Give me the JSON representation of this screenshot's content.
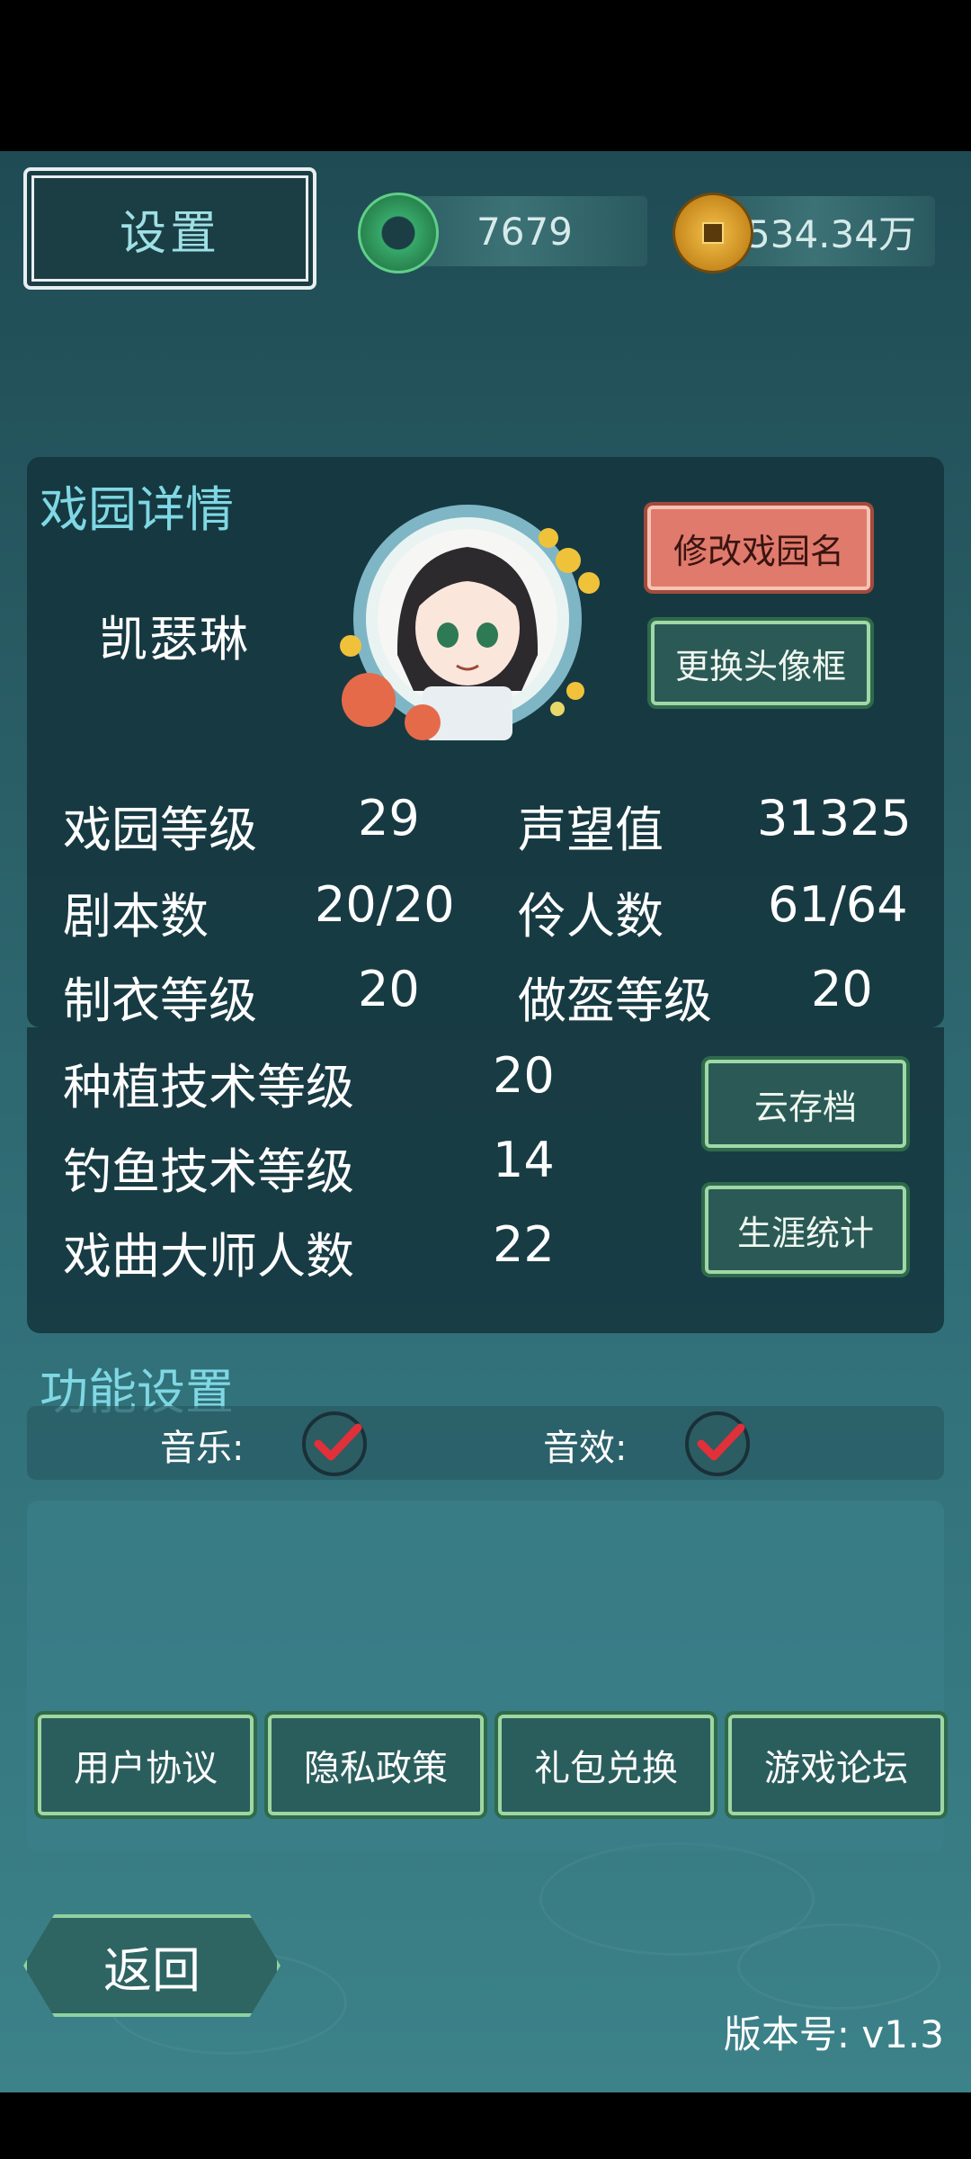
{
  "header": {
    "settings_label": "设置",
    "jade_amount": "7679",
    "gold_amount": "534.34万"
  },
  "garden": {
    "title": "戏园详情",
    "player_name": "凯瑟琳",
    "rename_button": "修改戏园名",
    "change_frame_button": "更换头像框",
    "stats": [
      {
        "label": "戏园等级",
        "value": "29"
      },
      {
        "label": "声望值",
        "value": "31325"
      },
      {
        "label": "剧本数",
        "value": "20/20"
      },
      {
        "label": "伶人数",
        "value": "61/64"
      },
      {
        "label": "制衣等级",
        "value": "20"
      },
      {
        "label": "做盔等级",
        "value": "20"
      },
      {
        "label": "种植技术等级",
        "value": "20"
      },
      {
        "label": "钓鱼技术等级",
        "value": "14"
      },
      {
        "label": "戏曲大师人数",
        "value": "22"
      }
    ],
    "cloud_save_button": "云存档",
    "career_stats_button": "生涯统计"
  },
  "functions": {
    "title": "功能设置",
    "music_label": "音乐:",
    "music_on": true,
    "sfx_label": "音效:",
    "sfx_on": true
  },
  "footer_buttons": [
    "用户协议",
    "隐私政策",
    "礼包兑换",
    "游戏论坛"
  ],
  "back_label": "返回",
  "version": "版本号: v1.3",
  "colors": {
    "accent_title": "#7fd8e4",
    "check_red": "#e0303a"
  }
}
